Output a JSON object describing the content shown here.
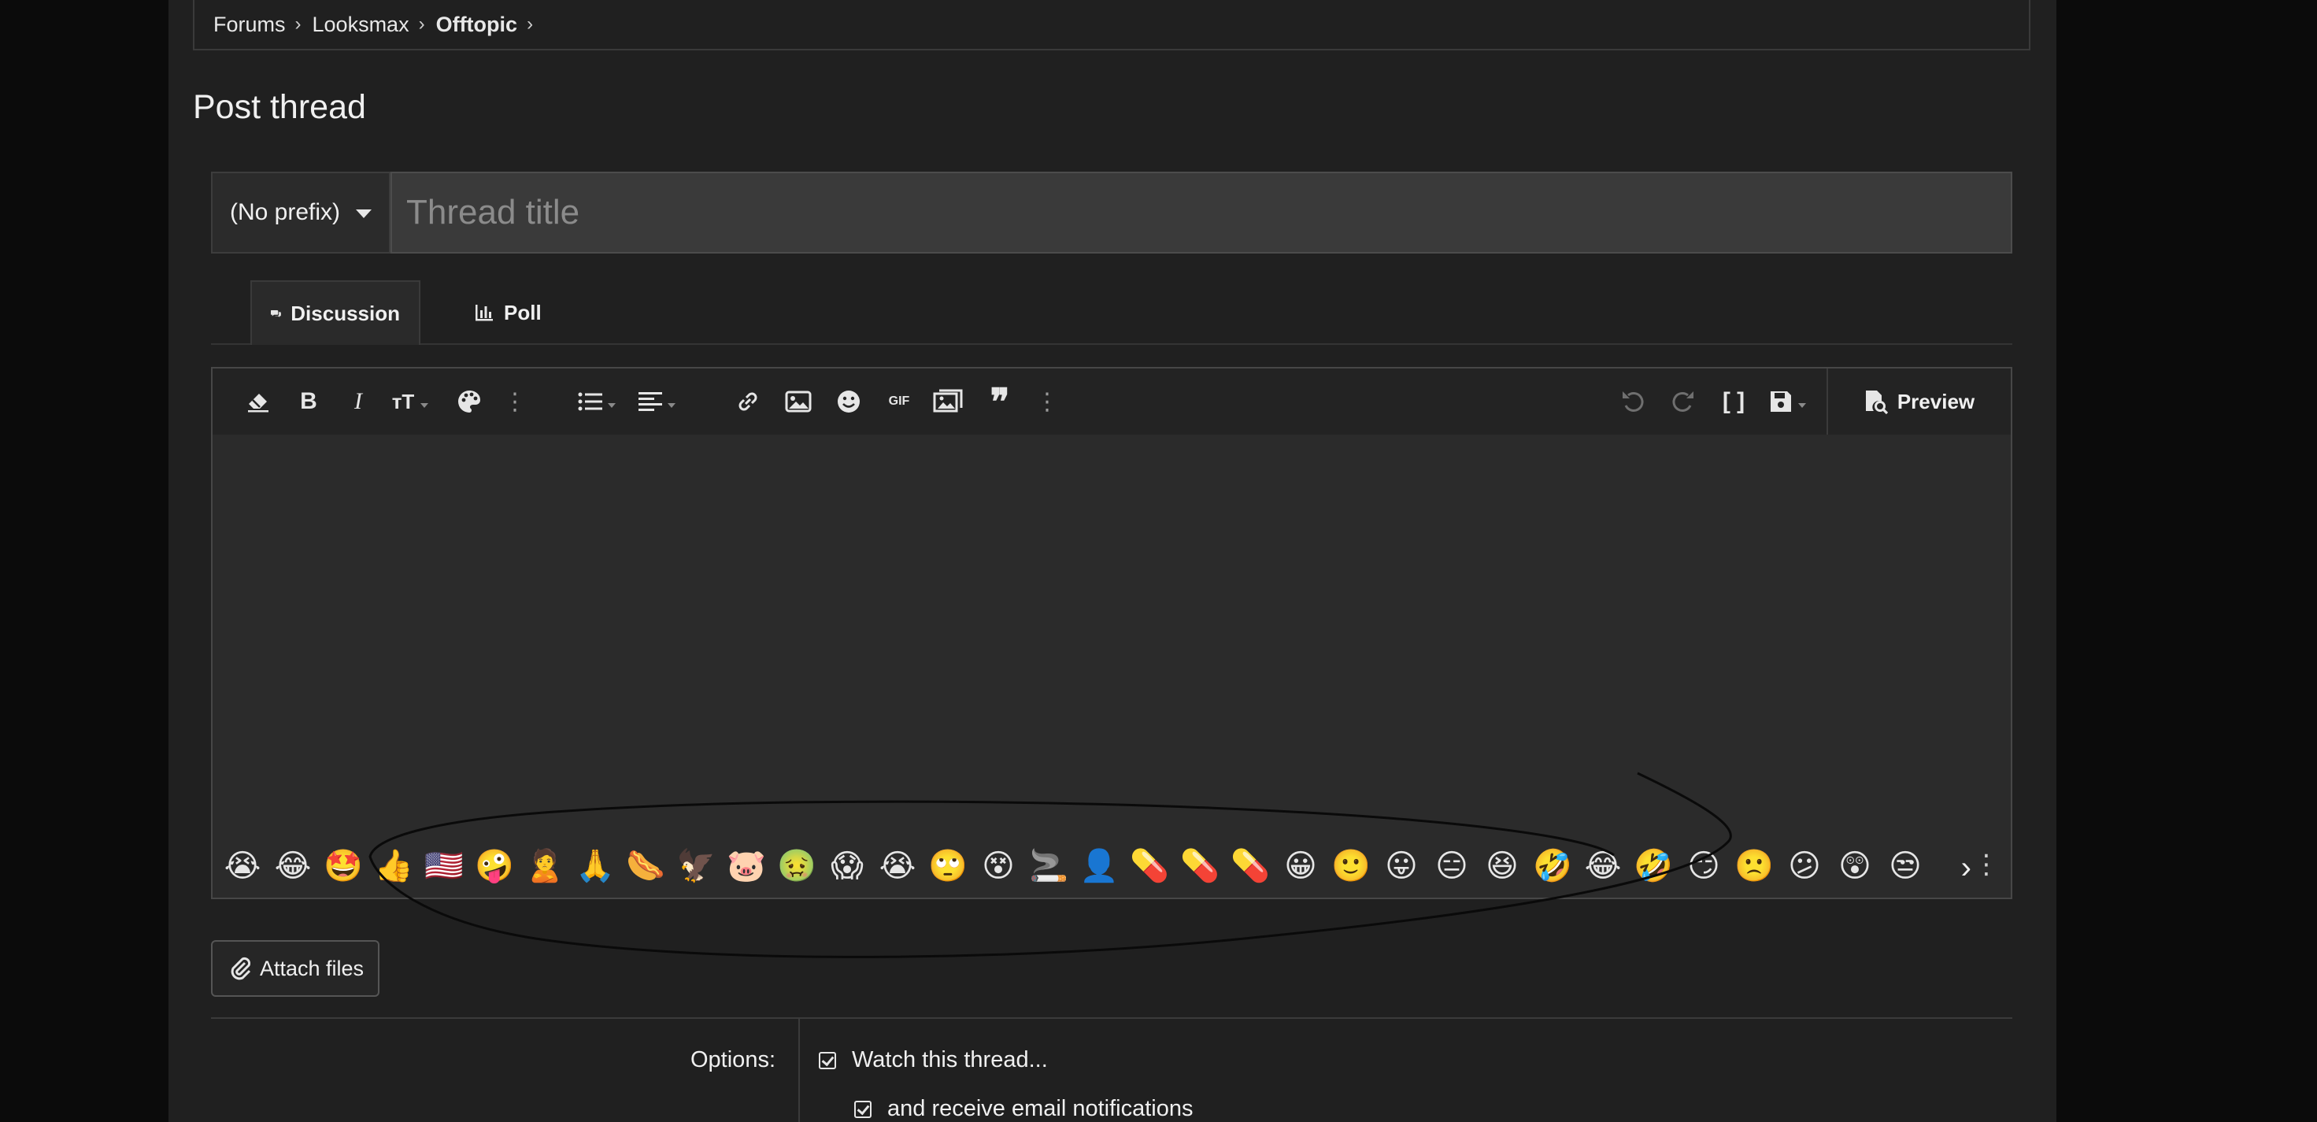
{
  "breadcrumb": [
    {
      "label": "Forums"
    },
    {
      "label": "Looksmax"
    },
    {
      "label": "Offtopic"
    }
  ],
  "page": {
    "title": "Post thread"
  },
  "thread_form": {
    "prefix_selected": "(No prefix)",
    "title_placeholder": "Thread title",
    "title_value": ""
  },
  "tabs": [
    {
      "label": "Discussion",
      "active": true
    },
    {
      "label": "Poll",
      "active": false
    }
  ],
  "editor": {
    "preview_label": "Preview",
    "gif_label": "GIF",
    "toolbar_left_icons": [
      "eraser-icon",
      "bold-icon",
      "italic-icon",
      "text-size-icon",
      "palette-icon",
      "more-vertical-icon",
      "list-icon",
      "align-icon",
      "link-icon",
      "image-icon",
      "smilie-icon",
      "gif-icon",
      "media-icon",
      "quote-icon",
      "more-vertical-icon"
    ],
    "toolbar_right_icons": [
      "undo-icon",
      "redo-icon",
      "bbcode-toggle-icon",
      "save-draft-icon"
    ],
    "smilies": [
      "😭",
      "😂",
      "🤩",
      "👍",
      "🇺🇸",
      "🤪",
      "🙎",
      "🙏",
      "🌭",
      "🦅",
      "🐷",
      "🤢",
      "😱",
      "😭",
      "🙄",
      "😵",
      "🚬",
      "👤",
      "💊",
      "💊",
      "💊",
      "😀",
      "🙂",
      "😛",
      "😑",
      "😆",
      "🤣",
      "😂",
      "🤣",
      "😏",
      "🙁",
      "😕",
      "😲",
      "😒"
    ]
  },
  "attach": {
    "label": "Attach files"
  },
  "options": {
    "label": "Options:",
    "watch_label": "Watch this thread...",
    "email_label": "and receive email notifications",
    "watch_checked": true,
    "email_checked": true
  },
  "colors": {
    "page_bg": "#202020",
    "outer_bg": "#0b0b0b",
    "editor_bg": "#2b2b2b"
  }
}
